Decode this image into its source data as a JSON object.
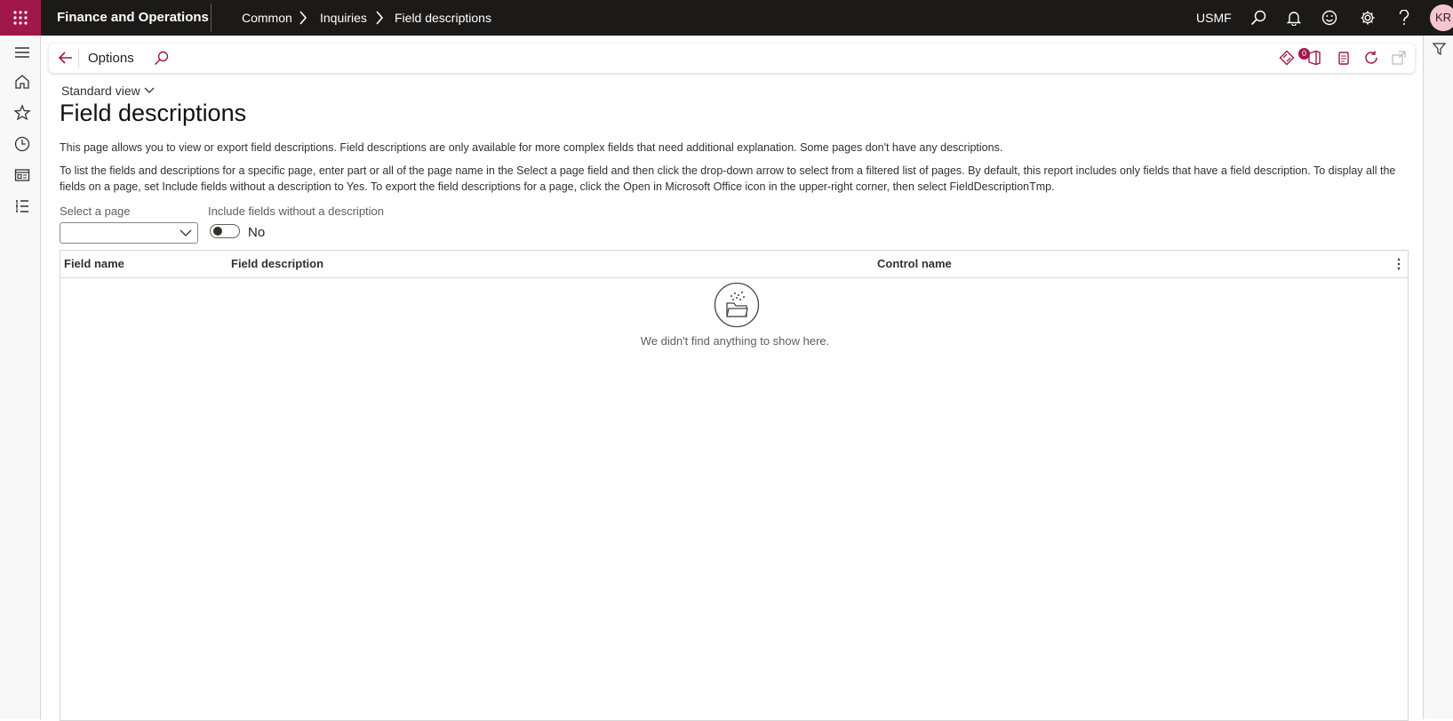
{
  "app": {
    "name": "Finance and Operations",
    "company": "USMF",
    "user_initials": "KR"
  },
  "breadcrumb": [
    "Common",
    "Inquiries",
    "Field descriptions"
  ],
  "actionpane": {
    "options_label": "Options",
    "badge_count": "0"
  },
  "view": {
    "label": "Standard view"
  },
  "page": {
    "title": "Field descriptions",
    "description1": "This page allows you to view or export field descriptions. Field descriptions are only available for more complex fields that need additional explanation. Some pages don't have any descriptions.",
    "description2": "To list the fields and descriptions for a specific page, enter part or all of the page name in the Select a page field and then click the drop-down arrow to select from a filtered list of pages. By default, this report includes only fields that have a field description. To display all the fields on a page, set Include fields without a description to Yes. To export the field descriptions for a page, click the Open in Microsoft Office icon in the upper-right corner, then select FieldDescriptionTmp."
  },
  "filters": {
    "select_page_label": "Select a page",
    "select_page_value": "",
    "include_label": "Include fields without a description",
    "include_value": "No"
  },
  "grid": {
    "columns": [
      "Field name",
      "Field description",
      "Control name"
    ],
    "rows": [],
    "empty_message": "We didn't find anything to show here."
  },
  "colors": {
    "topbar": "#1b1a19",
    "waffle": "#a0174a",
    "accent": "#a0174a"
  }
}
